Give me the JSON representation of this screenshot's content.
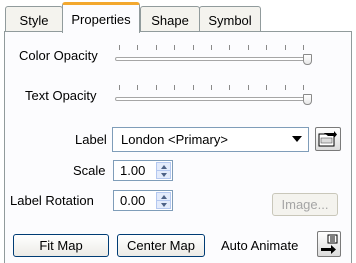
{
  "tabs": [
    {
      "label": "Style",
      "active": false
    },
    {
      "label": "Properties",
      "active": true
    },
    {
      "label": "Shape",
      "active": false
    },
    {
      "label": "Symbol",
      "active": false
    }
  ],
  "color_opacity": {
    "label": "Color Opacity",
    "value_fraction": 1.0
  },
  "text_opacity": {
    "label": "Text Opacity",
    "value_fraction": 1.0
  },
  "label_field": {
    "label": "Label",
    "value": "London <Primary>"
  },
  "scale": {
    "label": "Scale",
    "value": "1.00"
  },
  "label_rotation": {
    "label": "Label Rotation",
    "value": "0.00"
  },
  "image_button": {
    "label": "Image...",
    "enabled": false
  },
  "fit_map_button": {
    "label": "Fit Map"
  },
  "center_map_button": {
    "label": "Center Map"
  },
  "auto_animate": {
    "label": "Auto Animate"
  },
  "colors": {
    "active_tab_accent": "#f3a82e",
    "field_border": "#7f9db9"
  }
}
